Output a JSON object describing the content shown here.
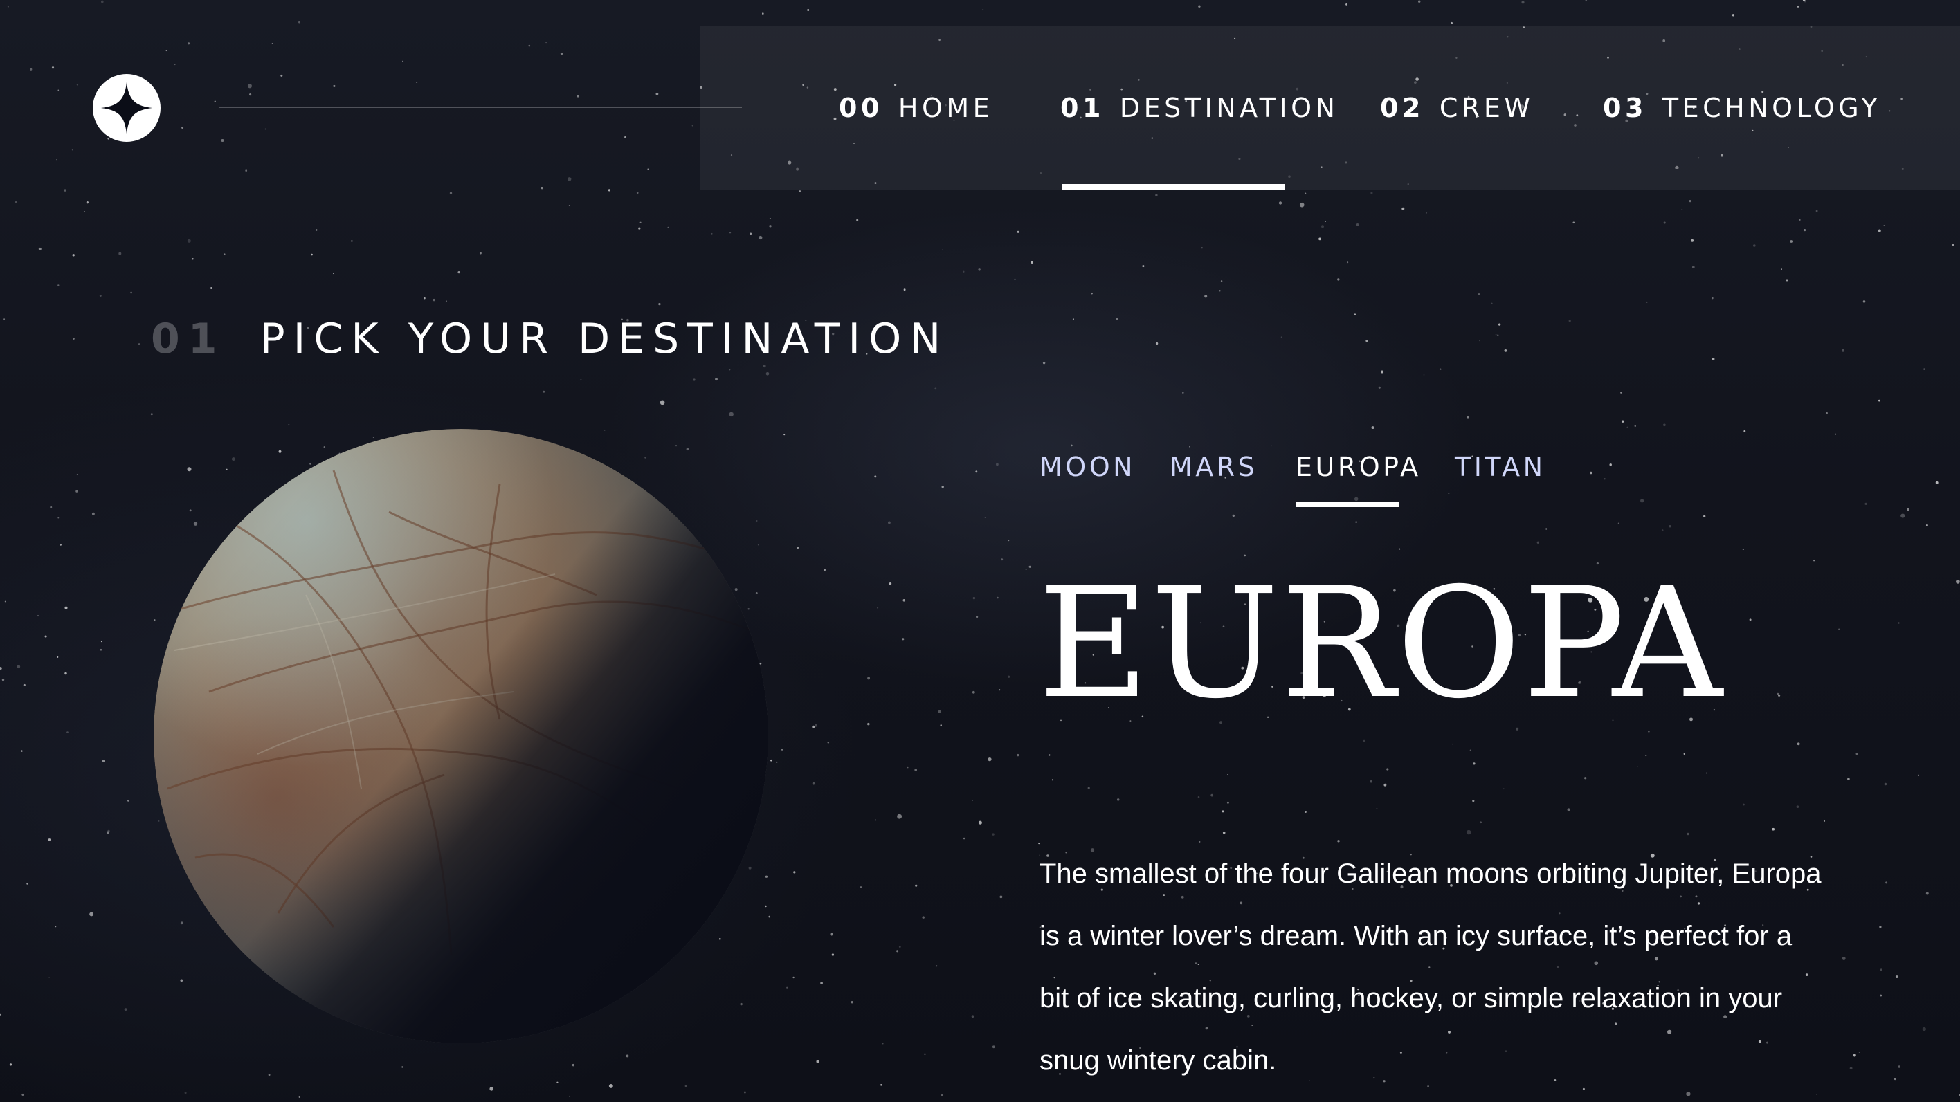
{
  "brand": {
    "logo_icon": "star-logo-icon"
  },
  "nav": {
    "items": [
      {
        "num": "00",
        "label": "HOME",
        "active": false
      },
      {
        "num": "01",
        "label": "DESTINATION",
        "active": true
      },
      {
        "num": "02",
        "label": "CREW",
        "active": false
      },
      {
        "num": "03",
        "label": "TECHNOLOGY",
        "active": false
      }
    ]
  },
  "section": {
    "num": "01",
    "title": "PICK YOUR DESTINATION"
  },
  "tabs": [
    {
      "label": "MOON",
      "active": false
    },
    {
      "label": "MARS",
      "active": false
    },
    {
      "label": "EUROPA",
      "active": true
    },
    {
      "label": "TITAN",
      "active": false
    }
  ],
  "destination": {
    "name": "EUROPA",
    "description": "The smallest of the four Galilean moons orbiting Jupiter, Europa is a winter lover’s dream. With an icy surface, it’s perfect for a bit of ice skating, curling, hockey, or simple relaxation in your snug wintery cabin."
  },
  "colors": {
    "background": "#0b0d17",
    "accent_light": "#d0d6f9",
    "white": "#ffffff"
  }
}
